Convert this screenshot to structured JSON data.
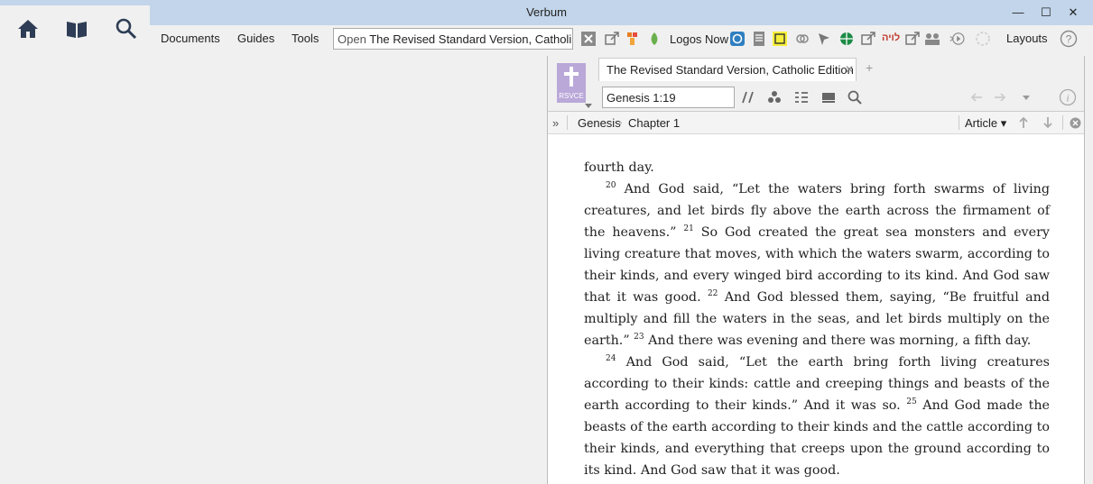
{
  "window": {
    "title": "Verbum"
  },
  "toolbar": {
    "menus": [
      "Documents",
      "Guides",
      "Tools"
    ],
    "command_prefix": "Open ",
    "command_value": "The Revised Standard Version, Catholi…",
    "logos_now": "Logos Now",
    "layouts": "Layouts",
    "hebrew_label": "לויה"
  },
  "panel": {
    "book_abbrev": "RSVCE",
    "tab_title": "The Revised Standard Version, Catholic Edition",
    "reference": "Genesis 1:19",
    "breadcrumb": [
      "Genesis",
      "Chapter 1"
    ],
    "article": "Article"
  },
  "content": {
    "p0": "fourth day.",
    "p1": [
      {
        "v": "20",
        "t": " And God said, “Let the waters bring forth swarms of living creatures, and let birds fly above the earth across the firmament of the heavens.” "
      },
      {
        "v": "21",
        "t": " So God created the great sea monsters and every living creature that moves, with which the waters swarm, according to their kinds, and every winged bird according to its kind. And God saw that it was good. "
      },
      {
        "v": "22",
        "t": " And God blessed them, saying, “Be fruitful and multiply and fill the waters in the seas, and let birds multiply on the earth.” "
      },
      {
        "v": "23",
        "t": " And there was evening and there was morning, a fifth day."
      }
    ],
    "p2": [
      {
        "v": "24",
        "t": " And God said, “Let the earth bring forth living creatures according to their kinds: cattle and creeping things and beasts of the earth according to their kinds.” And it was so. "
      },
      {
        "v": "25",
        "t": " And God made the beasts of the earth according to their kinds and the cattle according to their kinds, and everything that creeps upon the ground according to its kind. And God saw that it was good."
      }
    ]
  }
}
